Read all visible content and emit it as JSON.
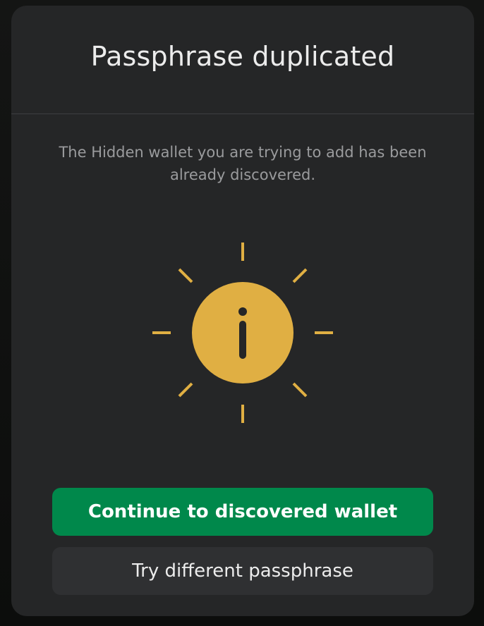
{
  "modal": {
    "title": "Passphrase duplicated",
    "description": "The Hidden wallet you are trying to add has been already discovered.",
    "icon": "info-icon"
  },
  "actions": {
    "primary_label": "Continue to discovered wallet",
    "secondary_label": "Try different passphrase"
  },
  "colors": {
    "accent_green": "#00884b",
    "info_yellow": "#e0af43",
    "modal_bg": "#252627"
  }
}
